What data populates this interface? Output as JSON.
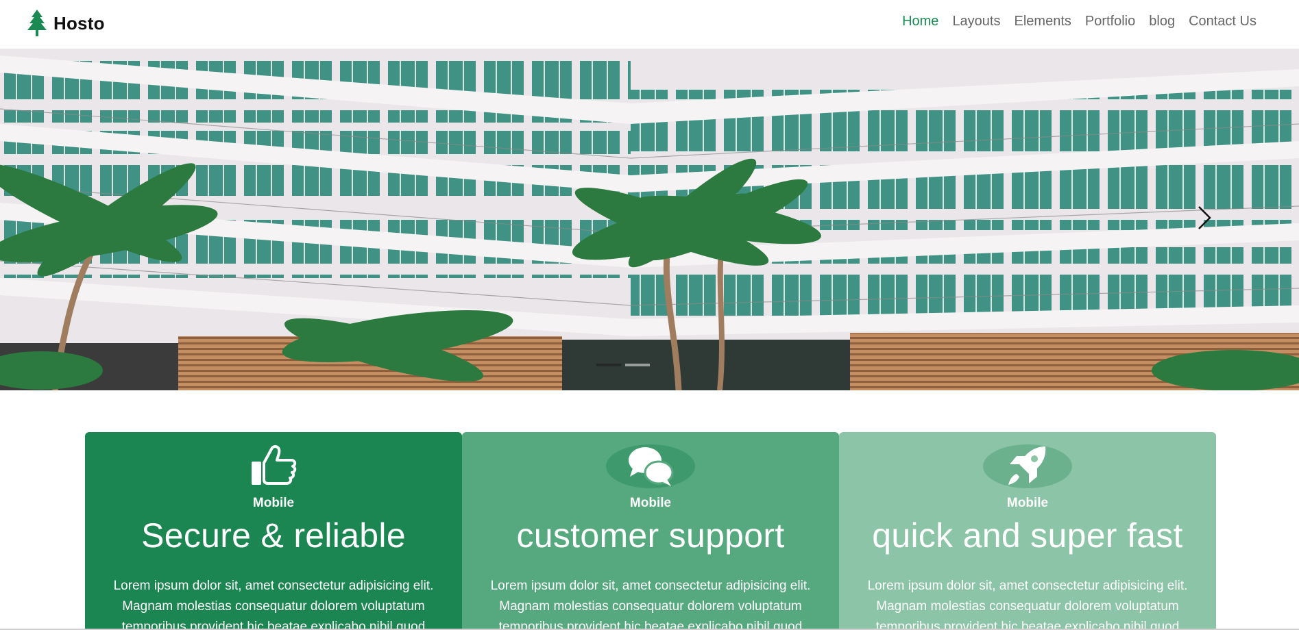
{
  "brand": {
    "name": "Hosto",
    "logo_icon": "pine-tree-icon",
    "logo_color": "#1a8a52"
  },
  "nav": {
    "items": [
      {
        "label": "Home",
        "active": true
      },
      {
        "label": "Layouts",
        "active": false
      },
      {
        "label": "Elements",
        "active": false
      },
      {
        "label": "Portfolio",
        "active": false
      },
      {
        "label": "blog",
        "active": false
      },
      {
        "label": "Contact Us",
        "active": false
      }
    ],
    "active_color": "#1a8a52"
  },
  "hero": {
    "image": "hotel-building-with-palm-trees",
    "next_icon": "chevron-right-icon",
    "slides": 2,
    "active_slide": 1
  },
  "features": [
    {
      "icon": "thumbs-up-icon",
      "kicker": "Mobile",
      "title": "Secure & reliable",
      "desc": "Lorem ipsum dolor sit, amet consectetur adipisicing elit. Magnam molestias consequatur dolorem voluptatum temporibus provident hic beatae explicabo nibil quod",
      "color": "#1b8651"
    },
    {
      "icon": "chat-bubbles-icon",
      "kicker": "Mobile",
      "title": "customer support",
      "desc": "Lorem ipsum dolor sit, amet consectetur adipisicing elit. Magnam molestias consequatur dolorem voluptatum temporibus provident hic beatae explicabo nibil quod",
      "color": "#56a97f"
    },
    {
      "icon": "rocket-icon",
      "kicker": "Mobile",
      "title": "quick and super fast",
      "desc": "Lorem ipsum dolor sit, amet consectetur adipisicing elit. Magnam molestias consequatur dolorem voluptatum temporibus provident hic beatae explicabo nibil quod",
      "color": "#8bc4a6"
    }
  ]
}
